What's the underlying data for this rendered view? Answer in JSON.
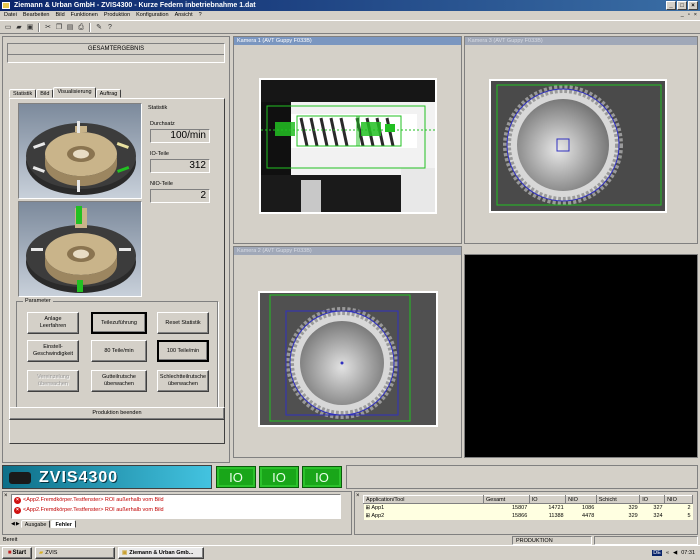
{
  "window": {
    "title": "Ziemann & Urban GmbH - ZVIS4300 - Kurze Federn inbetriebnahme 1.dat"
  },
  "menu": [
    "Datei",
    "Bearbeiten",
    "Bild",
    "Funktionen",
    "Produktion",
    "Konfiguration",
    "Ansicht",
    "?"
  ],
  "left": {
    "header": "GESAMTERGEBNIS",
    "tabs": [
      "Statistik",
      "Bild",
      "Visualisierung",
      "Auftrag"
    ],
    "stats": {
      "group_label": "Statistik",
      "throughput_label": "Durchsatz",
      "throughput_value": "100/min",
      "io_label": "IO-Teile",
      "io_value": "312",
      "nio_label": "NIO-Teile",
      "nio_value": "2"
    },
    "params_label": "Parameter",
    "buttons": [
      "Anlage\nLeerfahren",
      "Teilezuführung",
      "Reset Statistik",
      "Einstell-\nGeschwindigkeit",
      "80 Teile/min",
      "100 Teile/min",
      "Vereinzelung\nüberwachen",
      "Gutteilrutsche\nüberwachen",
      "Schlechtteilrutsche\nüberwachen"
    ],
    "end_button": "Produktion beenden"
  },
  "cameras": {
    "cam1": "Kamera 1 (AVT Guppy F033B)",
    "cam2": "Kamera 2 (AVT Guppy F033B)",
    "cam3": "Kamera 3 (AVT Guppy F033B)"
  },
  "logo": "ZVIS4300",
  "io_indicators": [
    "IO",
    "IO",
    "IO"
  ],
  "log": {
    "rows": [
      "<App2.Fremdkörper.Testfenster> ROI außerhalb vom Bild",
      "<App2.Fremdkörper.Testfenster> ROI außerhalb vom Bild"
    ],
    "tabs": [
      "Ausgabe",
      "Fehler"
    ]
  },
  "stats_table": {
    "headers": [
      "Application/Tool",
      "Gesamt",
      "IO",
      "NIO",
      "Schicht",
      "IO",
      "NIO"
    ],
    "rows": [
      [
        "App1",
        "15807",
        "14721",
        "1086",
        "329",
        "327",
        "2"
      ],
      [
        "App2",
        "15866",
        "11388",
        "4478",
        "329",
        "324",
        "5"
      ]
    ]
  },
  "statusbar": {
    "left": "Bereit",
    "mode": "PRODUKTION"
  },
  "taskbar": {
    "start": "Start",
    "items": [
      "ZVIS",
      "Ziemann & Urban Gmb..."
    ],
    "lang": "DE",
    "time": "07:31"
  },
  "colors": {
    "io_green": "#19a619",
    "title_blue": "#0a246a",
    "error_red": "#c00000"
  }
}
